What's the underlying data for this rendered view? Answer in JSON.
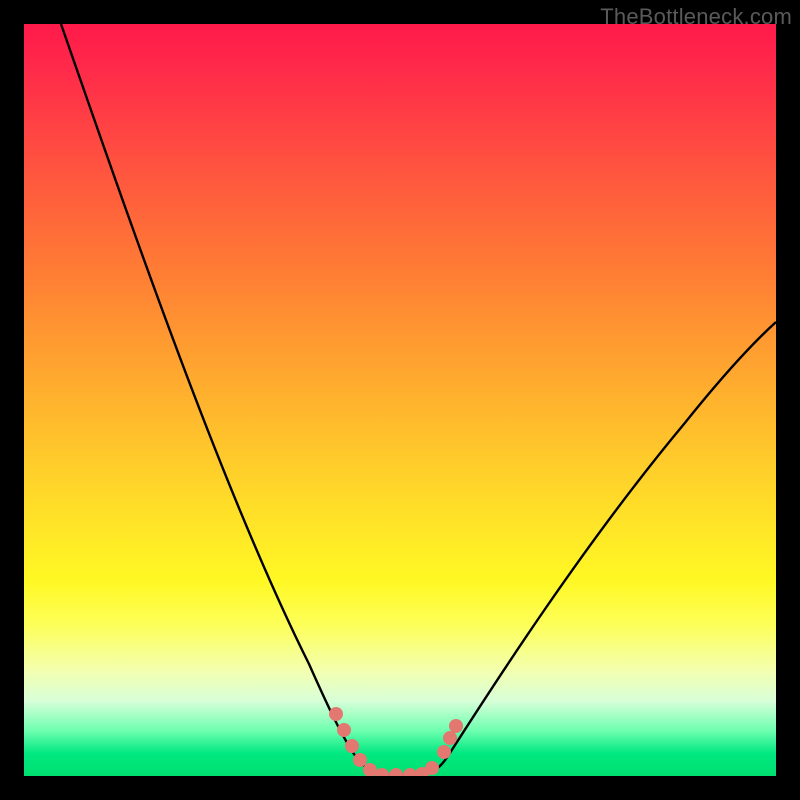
{
  "watermark": "TheBottleneck.com",
  "chart_data": {
    "type": "line",
    "title": "",
    "xlabel": "",
    "ylabel": "",
    "xlim": [
      0,
      100
    ],
    "ylim": [
      0,
      100
    ],
    "series": [
      {
        "name": "bottleneck-curve",
        "x": [
          5,
          10,
          15,
          20,
          25,
          30,
          35,
          38,
          40,
          42,
          44,
          46,
          48,
          50,
          52,
          55,
          60,
          65,
          70,
          75,
          80,
          85,
          90,
          95,
          100
        ],
        "y": [
          100,
          89,
          78,
          67,
          56,
          44,
          31,
          21,
          13,
          7,
          3,
          1,
          0,
          0,
          1,
          3,
          9,
          17,
          25,
          33,
          41,
          48,
          55,
          61,
          66
        ]
      }
    ],
    "markers": {
      "name": "highlight-dots",
      "color": "#e2786f",
      "points": [
        {
          "x": 41,
          "y": 9
        },
        {
          "x": 42,
          "y": 6
        },
        {
          "x": 43,
          "y": 3.5
        },
        {
          "x": 44,
          "y": 2
        },
        {
          "x": 46,
          "y": 0.5
        },
        {
          "x": 48,
          "y": 0
        },
        {
          "x": 50,
          "y": 0
        },
        {
          "x": 52,
          "y": 0.5
        },
        {
          "x": 53.5,
          "y": 2
        },
        {
          "x": 55,
          "y": 4.5
        },
        {
          "x": 56,
          "y": 7
        }
      ]
    },
    "gradient_stops": [
      {
        "pos": 0,
        "color": "#ff1a4a"
      },
      {
        "pos": 50,
        "color": "#ffd028"
      },
      {
        "pos": 80,
        "color": "#fdff5a"
      },
      {
        "pos": 100,
        "color": "#00e070"
      }
    ]
  }
}
